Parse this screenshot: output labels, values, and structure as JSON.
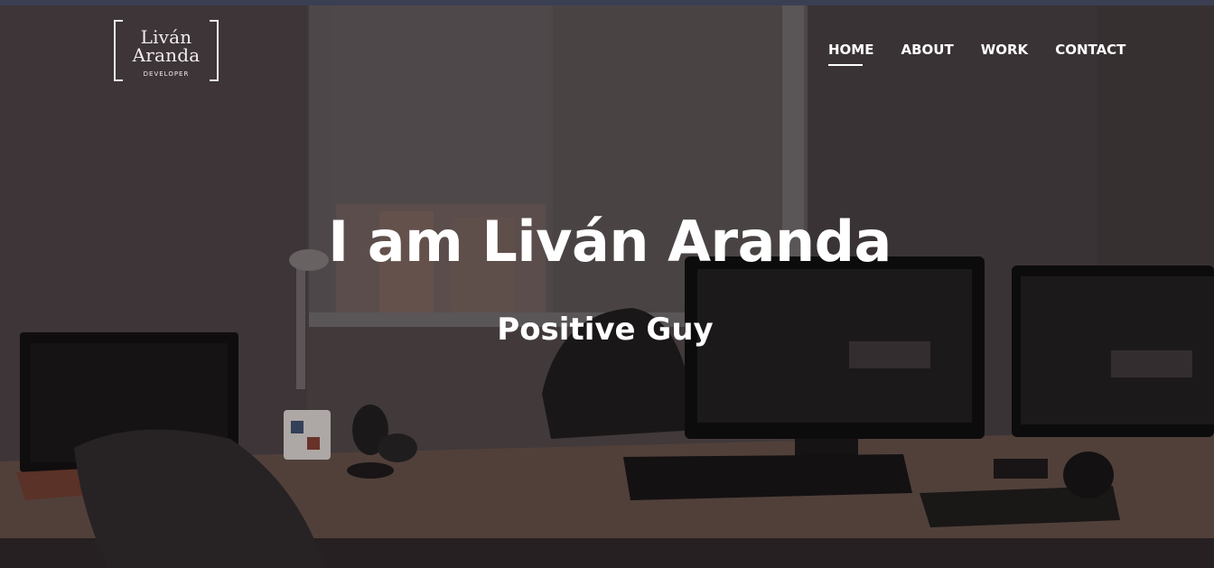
{
  "logo": {
    "line1": "Liván",
    "line2": "Aranda",
    "line3": "DEVELOPER"
  },
  "nav": {
    "items": [
      {
        "label": "HOME",
        "active": true
      },
      {
        "label": "ABOUT",
        "active": false
      },
      {
        "label": "WORK",
        "active": false
      },
      {
        "label": "CONTACT",
        "active": false
      }
    ]
  },
  "hero": {
    "title": "I am Liván Aranda",
    "subtitle": "Positive Guy"
  },
  "colors": {
    "text": "#ffffff",
    "top_strip": "#3b3f52"
  }
}
